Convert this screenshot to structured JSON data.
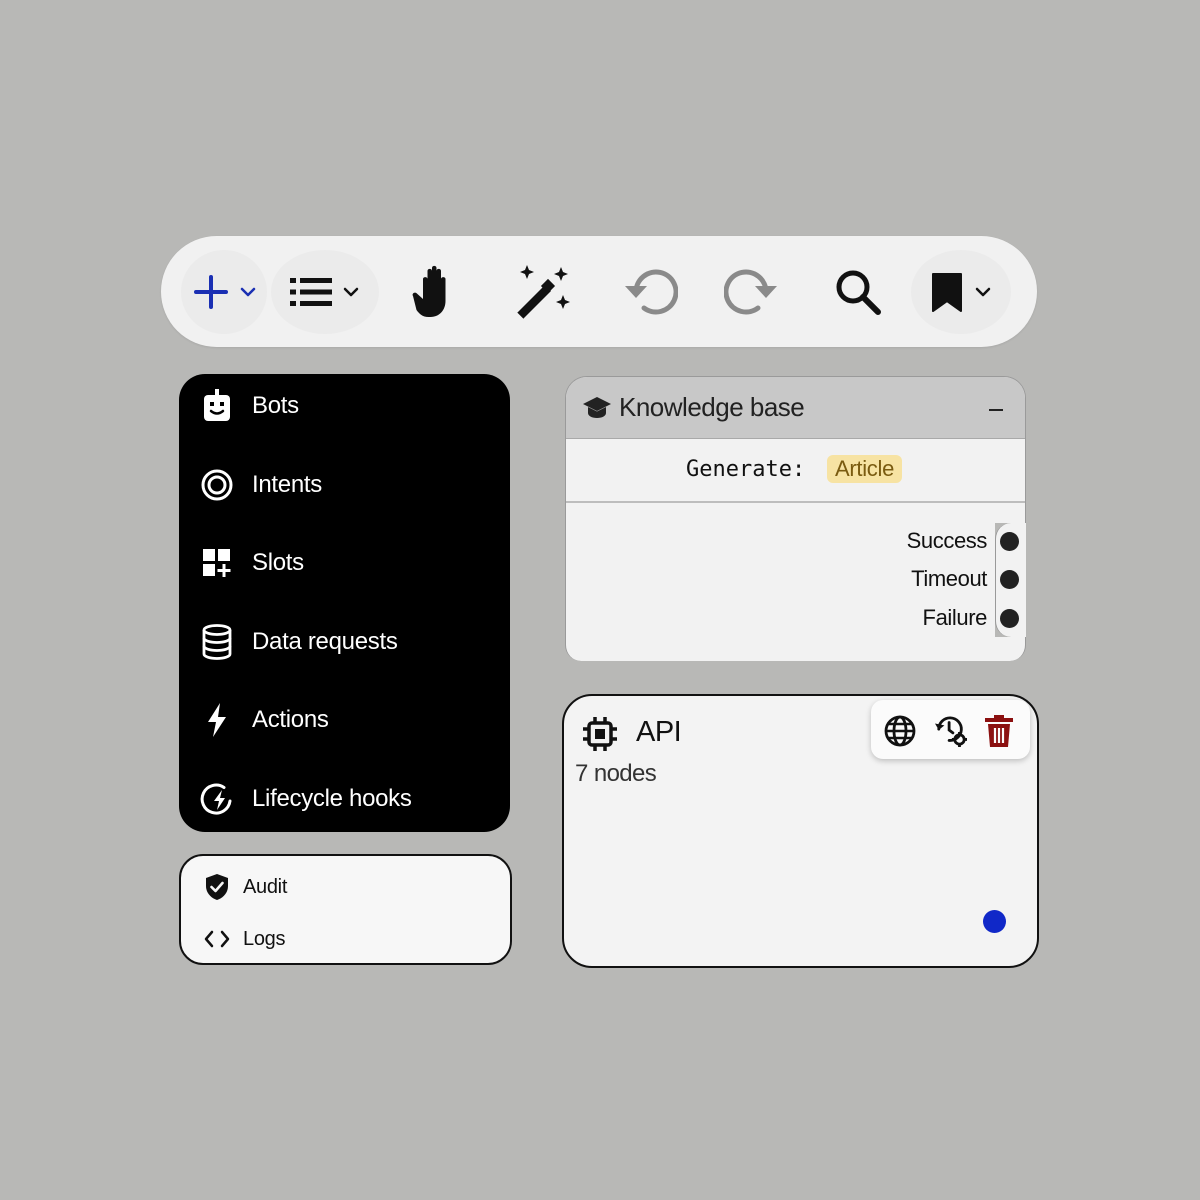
{
  "toolbar": {
    "buttons": [
      {
        "name": "add",
        "icon": "plus-icon",
        "color": "#1a2fb3",
        "has_dropdown": true
      },
      {
        "name": "list",
        "icon": "list-icon",
        "has_dropdown": true
      },
      {
        "name": "pan",
        "icon": "hand-icon"
      },
      {
        "name": "magic",
        "icon": "magic-wand-icon"
      },
      {
        "name": "undo",
        "icon": "undo-icon",
        "disabled": true
      },
      {
        "name": "redo",
        "icon": "redo-icon",
        "disabled": true
      },
      {
        "name": "search",
        "icon": "search-icon"
      },
      {
        "name": "bookmark",
        "icon": "bookmark-icon",
        "has_dropdown": true
      }
    ]
  },
  "sidebar": {
    "items": [
      {
        "label": "Bots",
        "icon": "robot-icon"
      },
      {
        "label": "Intents",
        "icon": "target-icon"
      },
      {
        "label": "Slots",
        "icon": "grid-plus-icon"
      },
      {
        "label": "Data requests",
        "icon": "database-icon"
      },
      {
        "label": "Actions",
        "icon": "lightning-icon"
      },
      {
        "label": "Lifecycle hooks",
        "icon": "cycle-lightning-icon"
      }
    ]
  },
  "bottom_menu": {
    "items": [
      {
        "label": "Audit",
        "icon": "shield-check-icon"
      },
      {
        "label": "Logs",
        "icon": "code-icon"
      }
    ]
  },
  "kb_node": {
    "title": "Knowledge base",
    "minimize_glyph": "–",
    "generate_label": "Generate:",
    "generate_value": "Article",
    "outputs": [
      "Success",
      "Timeout",
      "Failure"
    ]
  },
  "api_node": {
    "title": "API",
    "subtitle": "7 nodes",
    "actions": [
      "globe-icon",
      "history-settings-icon",
      "trash-icon"
    ],
    "accent": "#1028c8",
    "delete_color": "#8b1010"
  }
}
